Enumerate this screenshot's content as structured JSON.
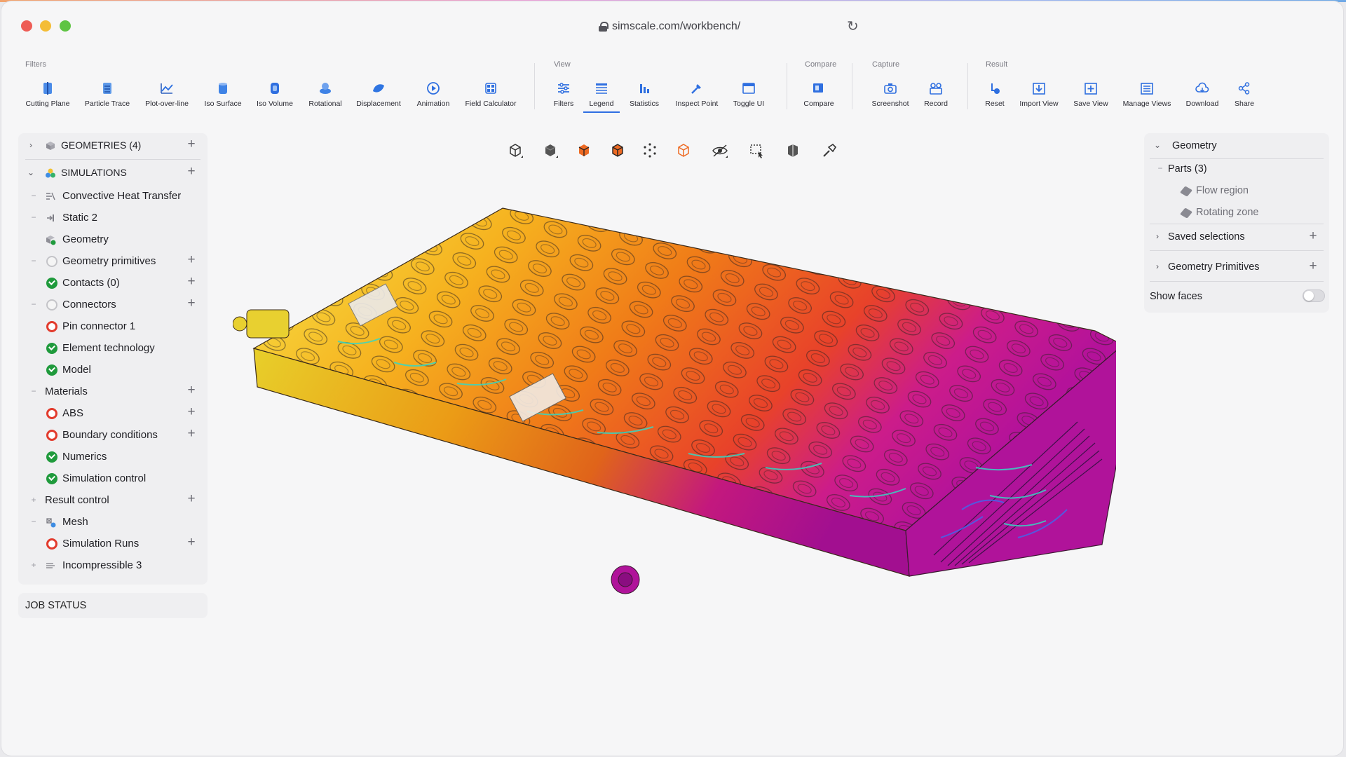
{
  "browser": {
    "url": "simscale.com/workbench/"
  },
  "toolbar": {
    "groups": [
      {
        "label": "Filters",
        "items": [
          {
            "label": "Cutting Plane",
            "icon": "cutting-plane-icon"
          },
          {
            "label": "Particle Trace",
            "icon": "particle-trace-icon"
          },
          {
            "label": "Plot-over-line",
            "icon": "plot-over-line-icon"
          },
          {
            "label": "Iso Surface",
            "icon": "iso-surface-icon"
          },
          {
            "label": "Iso Volume",
            "icon": "iso-volume-icon"
          },
          {
            "label": "Rotational",
            "icon": "rotational-icon"
          },
          {
            "label": "Displacement",
            "icon": "displacement-icon"
          },
          {
            "label": "Animation",
            "icon": "animation-icon"
          },
          {
            "label": "Field Calculator",
            "icon": "field-calculator-icon"
          }
        ]
      },
      {
        "label": "View",
        "items": [
          {
            "label": "Filters",
            "icon": "filters-icon"
          },
          {
            "label": "Legend",
            "icon": "legend-icon",
            "active": true
          },
          {
            "label": "Statistics",
            "icon": "statistics-icon"
          },
          {
            "label": "Inspect Point",
            "icon": "inspect-point-icon"
          },
          {
            "label": "Toggle UI",
            "icon": "toggle-ui-icon"
          }
        ]
      },
      {
        "label": "Compare",
        "items": [
          {
            "label": "Compare",
            "icon": "compare-icon"
          }
        ]
      },
      {
        "label": "Capture",
        "items": [
          {
            "label": "Screenshot",
            "icon": "camera-icon"
          },
          {
            "label": "Record",
            "icon": "record-icon"
          }
        ]
      },
      {
        "label": "Result",
        "items": [
          {
            "label": "Reset",
            "icon": "reset-icon"
          },
          {
            "label": "Import View",
            "icon": "import-view-icon"
          },
          {
            "label": "Save View",
            "icon": "save-view-icon"
          },
          {
            "label": "Manage Views",
            "icon": "manage-views-icon"
          },
          {
            "label": "Download",
            "icon": "download-icon"
          },
          {
            "label": "Share",
            "icon": "share-icon"
          }
        ]
      }
    ]
  },
  "tree": {
    "geometries": "GEOMETRIES (4)",
    "simulations": "SIMULATIONS",
    "items": [
      {
        "label": "Convective Heat Transfer",
        "icon": "heat-transfer-icon"
      },
      {
        "label": "Static 2",
        "icon": "static-icon"
      },
      {
        "label": "Geometry",
        "icon": "geometry-icon"
      },
      {
        "label": "Geometry primitives",
        "icon": "status-empty-icon"
      },
      {
        "label": "Contacts (0)",
        "icon": "status-ok-icon"
      },
      {
        "label": "Connectors",
        "icon": "status-empty-icon"
      },
      {
        "label": "Pin connector 1",
        "icon": "status-error-icon"
      },
      {
        "label": "Element technology",
        "icon": "status-ok-icon"
      },
      {
        "label": "Model",
        "icon": "status-ok-icon"
      },
      {
        "label": "Materials",
        "icon": ""
      },
      {
        "label": "ABS",
        "icon": "status-error-icon"
      },
      {
        "label": "Boundary conditions",
        "icon": "status-error-icon"
      },
      {
        "label": "Numerics",
        "icon": "status-ok-icon"
      },
      {
        "label": "Simulation control",
        "icon": "status-ok-icon"
      },
      {
        "label": "Result control",
        "icon": ""
      },
      {
        "label": "Mesh",
        "icon": "mesh-icon"
      },
      {
        "label": "Simulation Runs",
        "icon": "status-error-icon"
      },
      {
        "label": "Incompressible 3",
        "icon": "incompressible-icon"
      }
    ]
  },
  "job_status": "JOB STATUS",
  "viewbar": {
    "buttons": [
      "iso-view-icon",
      "solid-view-icon",
      "surface-view-icon",
      "surface-edges-icon",
      "points-view-icon",
      "wireframe-view-icon",
      "hide-icon",
      "box-select-icon",
      "clip-icon",
      "pick-icon"
    ]
  },
  "right_panel": {
    "geometry": "Geometry",
    "parts": "Parts (3)",
    "part_items": [
      "Flow region",
      "Rotating zone"
    ],
    "saved_selections": "Saved selections",
    "geometry_primitives": "Geometry Primitives",
    "show_faces": "Show faces",
    "show_faces_on": false
  },
  "colors": {
    "accent": "#2f6ee2",
    "ok": "#1f9a3c",
    "error": "#e23b2d",
    "heat_low": "#f2e23c",
    "heat_mid": "#f08a1e",
    "heat_high": "#c51a9a"
  }
}
